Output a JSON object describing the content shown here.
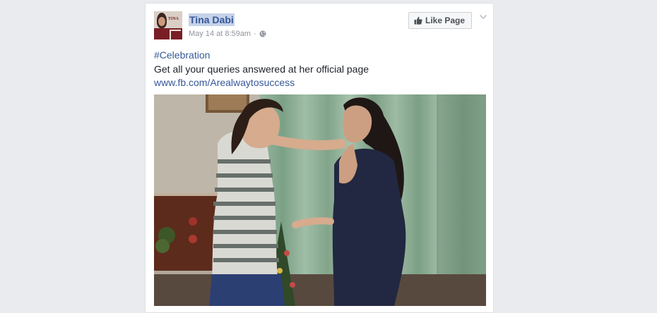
{
  "post": {
    "author": "Tina Dabi",
    "timestamp": "May 14 at 8:59am",
    "separator": "·",
    "privacy_icon": "globe-icon",
    "like_page_label": "Like Page",
    "hashtag": "#Celebration",
    "message": "Get all your queries answered at her official page",
    "link": "www.fb.com/Arealwaytosuccess",
    "avatar_text": "TINA"
  },
  "colors": {
    "link": "#365899",
    "page_bg": "#e9ebee",
    "meta_text": "#90949c"
  }
}
